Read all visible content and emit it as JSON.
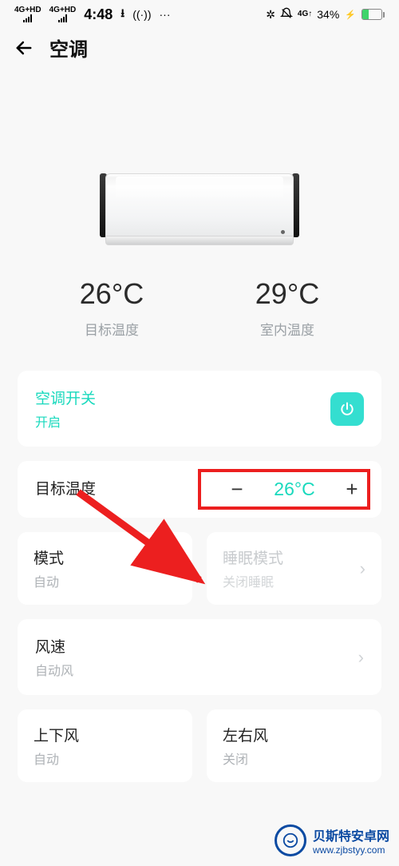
{
  "status": {
    "net1": "4G+HD",
    "net2": "4G+HD",
    "time": "4:48",
    "signal4g": "4G↑",
    "battery_pct": "34%"
  },
  "header": {
    "title": "空调"
  },
  "temps": {
    "target_value": "26°C",
    "target_label": "目标温度",
    "room_value": "29°C",
    "room_label": "室内温度"
  },
  "power_card": {
    "title": "空调开关",
    "status": "开启"
  },
  "target_card": {
    "label": "目标温度",
    "value": "26°C"
  },
  "mode_card": {
    "title": "模式",
    "sub": "自动"
  },
  "sleep_card": {
    "title": "睡眠模式",
    "sub": "关闭睡眠"
  },
  "fan_card": {
    "title": "风速",
    "sub": "自动风"
  },
  "vswing_card": {
    "title": "上下风",
    "sub": "自动"
  },
  "hswing_card": {
    "title": "左右风",
    "sub": "关闭"
  },
  "watermark": {
    "name": "贝斯特安卓网",
    "url": "www.zjbstyy.com"
  }
}
